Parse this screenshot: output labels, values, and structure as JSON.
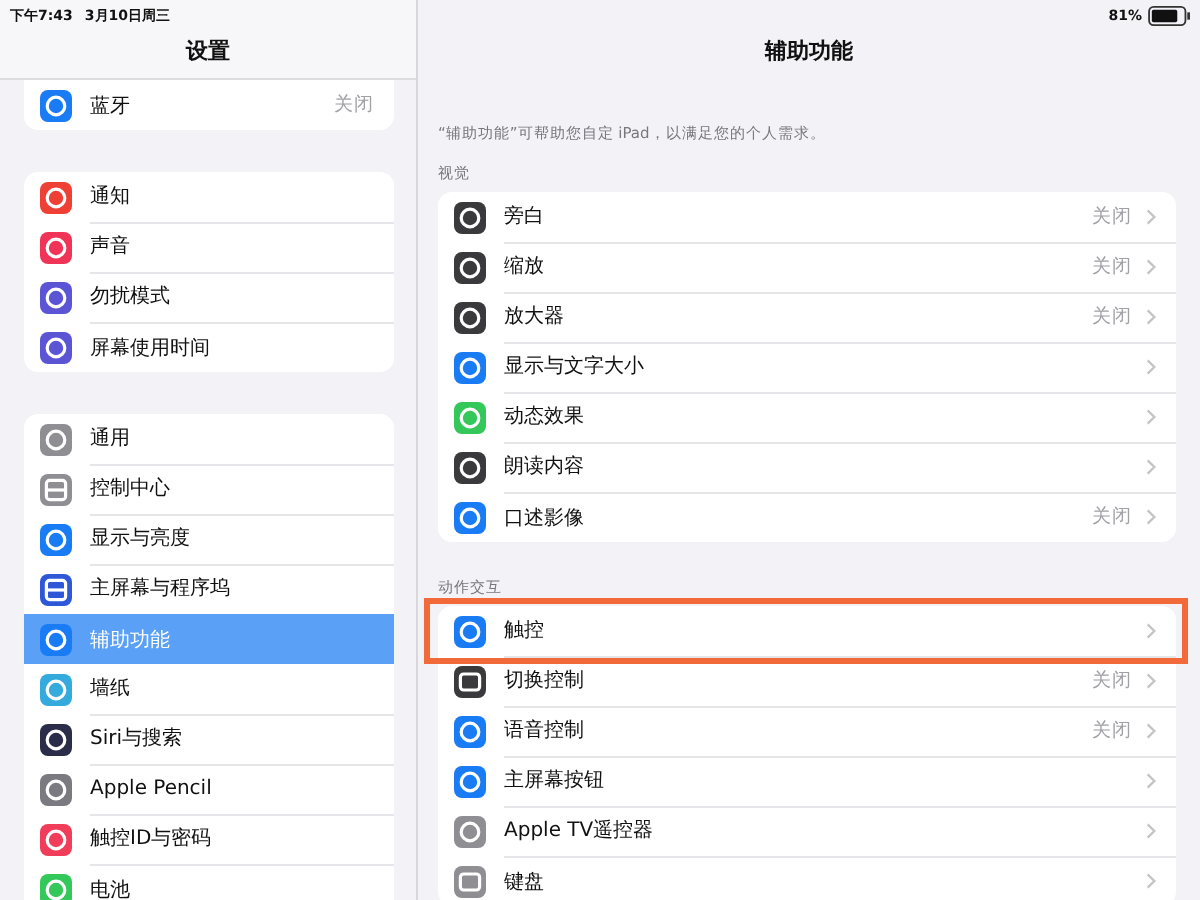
{
  "status_bar": {
    "time": "下午7:43",
    "date": "3月10日周三",
    "battery": "81%"
  },
  "sidebar": {
    "title": "设置",
    "groups": [
      {
        "items": [
          {
            "label": "蓝牙",
            "value": "关闭",
            "color": "#1a7cf5",
            "selected": false
          }
        ]
      },
      {
        "items": [
          {
            "label": "通知",
            "color": "#ee4035",
            "selected": false
          },
          {
            "label": "声音",
            "color": "#ef3457",
            "selected": false
          },
          {
            "label": "勿扰模式",
            "color": "#5b55d6",
            "selected": false
          },
          {
            "label": "屏幕使用时间",
            "color": "#5b55d6",
            "selected": false
          }
        ]
      },
      {
        "items": [
          {
            "label": "通用",
            "color": "#8e8e93",
            "selected": false
          },
          {
            "label": "控制中心",
            "color": "#8e8e93",
            "selected": false
          },
          {
            "label": "显示与亮度",
            "color": "#1a7cf5",
            "selected": false
          },
          {
            "label": "主屏幕与程序坞",
            "color": "#2e58d8",
            "selected": false
          },
          {
            "label": "辅助功能",
            "color": "#1a7cf5",
            "selected": true
          },
          {
            "label": "墙纸",
            "color": "#35aadc",
            "selected": false
          },
          {
            "label": "Siri与搜索",
            "color": "#2b2b4a",
            "selected": false
          },
          {
            "label": "Apple Pencil",
            "color": "#7a7a80",
            "selected": false
          },
          {
            "label": "触控ID与密码",
            "color": "#ef3d5a",
            "selected": false
          },
          {
            "label": "电池",
            "color": "#34c759",
            "selected": false
          }
        ]
      }
    ]
  },
  "detail": {
    "title": "辅助功能",
    "description": "“辅助功能”可帮助您自定 iPad，以满足您的个人需求。",
    "sections": [
      {
        "header": "视觉",
        "items": [
          {
            "label": "旁白",
            "value": "关闭",
            "color": "#3a3a3c",
            "highlighted": false
          },
          {
            "label": "缩放",
            "value": "关闭",
            "color": "#3a3a3c",
            "highlighted": false
          },
          {
            "label": "放大器",
            "value": "关闭",
            "color": "#3a3a3c",
            "highlighted": false
          },
          {
            "label": "显示与文字大小",
            "color": "#1a7cf5",
            "highlighted": false
          },
          {
            "label": "动态效果",
            "color": "#34c759",
            "highlighted": false
          },
          {
            "label": "朗读内容",
            "color": "#3a3a3c",
            "highlighted": false
          },
          {
            "label": "口述影像",
            "value": "关闭",
            "color": "#1a7cf5",
            "highlighted": false
          }
        ]
      },
      {
        "header": "动作交互",
        "items": [
          {
            "label": "触控",
            "color": "#1a7cf5",
            "highlighted": true
          },
          {
            "label": "切换控制",
            "value": "关闭",
            "color": "#3a3a3c",
            "highlighted": false
          },
          {
            "label": "语音控制",
            "value": "关闭",
            "color": "#1a7cf5",
            "highlighted": false
          },
          {
            "label": "主屏幕按钮",
            "color": "#1a7cf5",
            "highlighted": false
          },
          {
            "label": "Apple TV遥控器",
            "color": "#8e8e93",
            "highlighted": false
          },
          {
            "label": "键盘",
            "color": "#8e8e93",
            "highlighted": false
          }
        ]
      }
    ]
  }
}
